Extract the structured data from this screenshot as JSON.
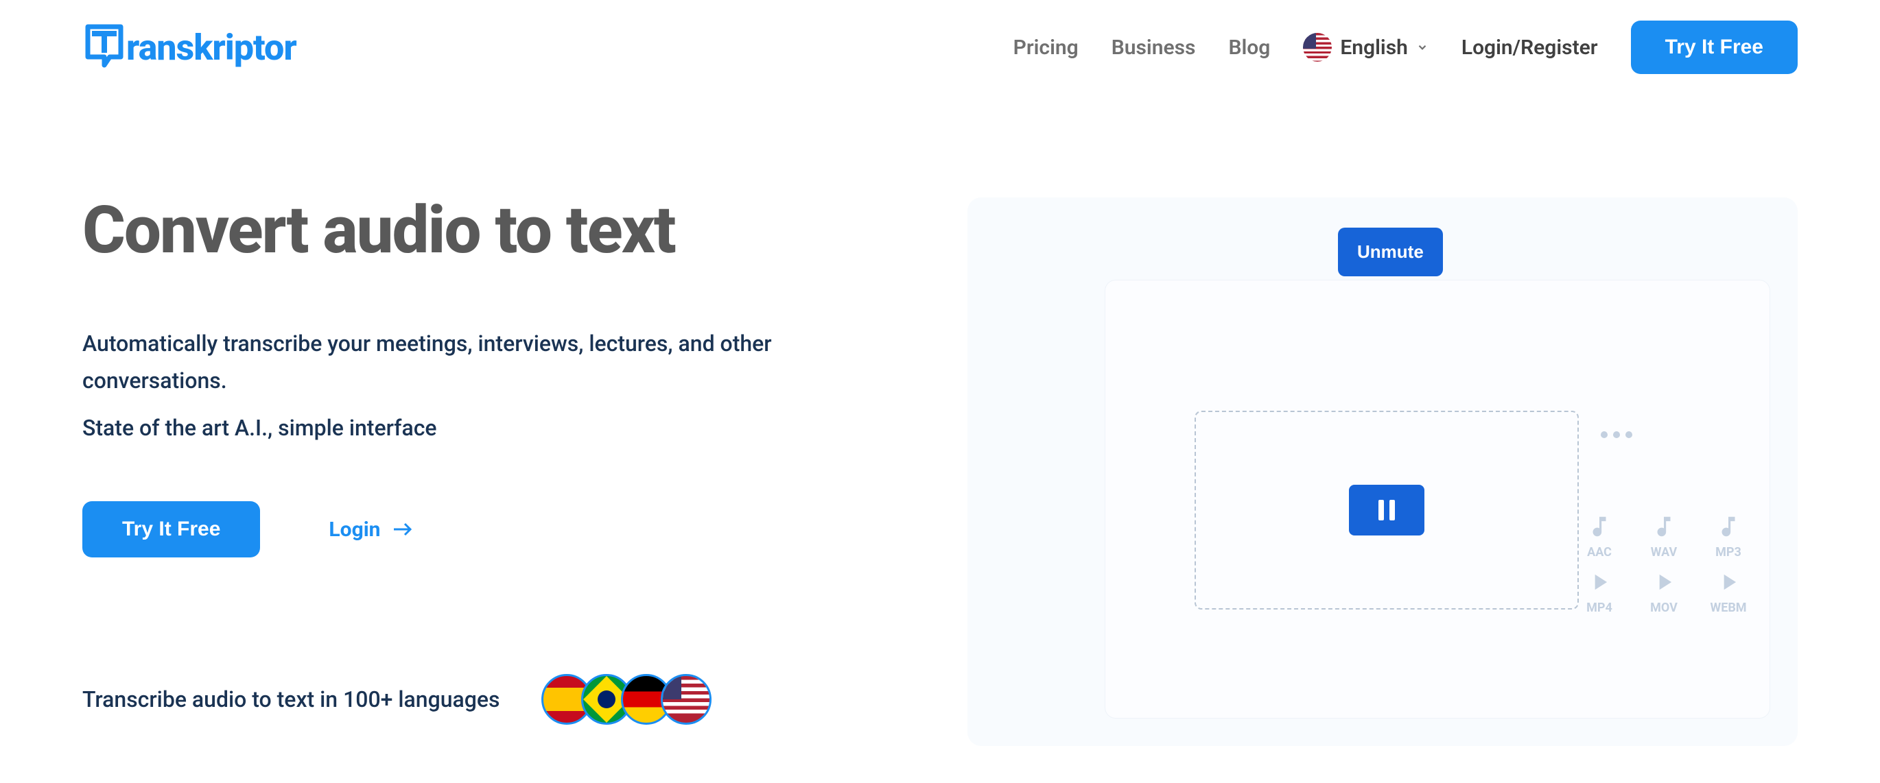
{
  "header": {
    "logo_text": "ranskriptor",
    "nav": {
      "pricing": "Pricing",
      "business": "Business",
      "blog": "Blog"
    },
    "language": {
      "label": "English"
    },
    "login_register": "Login/Register",
    "try_free": "Try It Free"
  },
  "hero": {
    "title": "Convert audio to text",
    "description1": "Automatically transcribe your meetings, interviews, lectures, and other conversations.",
    "description2": "State of the art A.I., simple interface",
    "cta_button": "Try It Free",
    "login_link": "Login",
    "languages_text": "Transcribe audio to text in 100+ languages"
  },
  "illustration": {
    "unmute_label": "Unmute",
    "file_types": [
      "AAC",
      "WAV",
      "MP3",
      "MP4",
      "MOV",
      "WEBM"
    ]
  }
}
